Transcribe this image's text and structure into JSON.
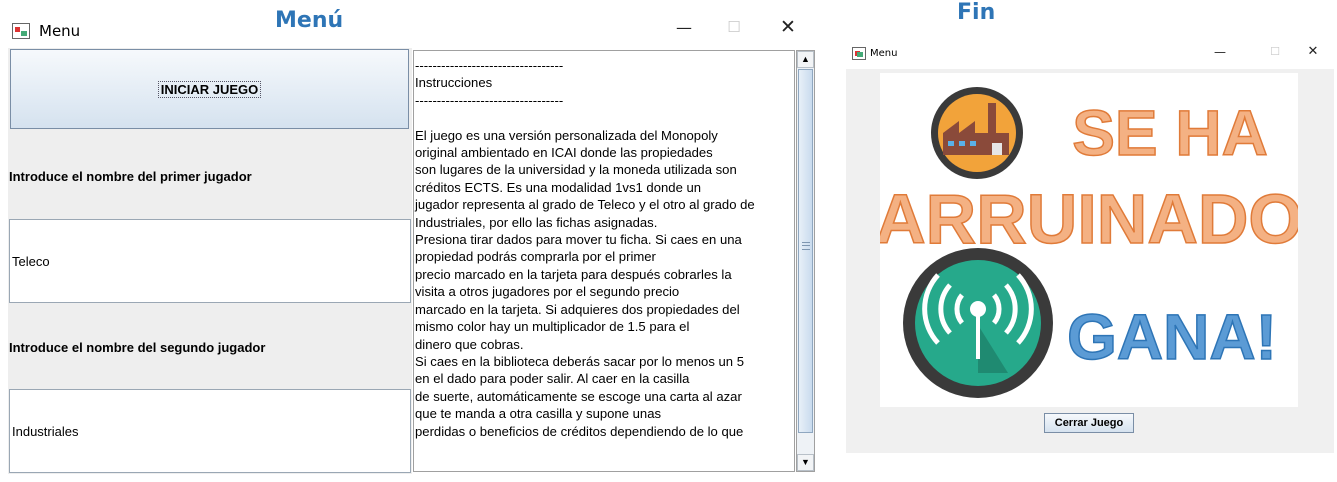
{
  "captions": {
    "menu": "Menú",
    "end": "Fin"
  },
  "menu_window": {
    "title": "Menu",
    "start_button": "INICIAR JUEGO",
    "player1_label": "Introduce el nombre del primer jugador",
    "player1_value": "Teleco",
    "player2_label": "Introduce el nombre del segundo jugador",
    "player2_value": "Industriales",
    "instructions": "----------------------------------\nInstrucciones\n----------------------------------\n\nEl juego es una versión personalizada del Monopoly\noriginal ambientado en ICAI donde las propiedades\nson lugares de la universidad y la moneda utilizada son\ncréditos ECTS. Es una modalidad 1vs1 donde un\njugador representa al grado de Teleco y el otro al grado de\nIndustriales, por ello las fichas asignadas.\nPresiona tirar dados para mover tu ficha. Si caes en una\npropiedad podrás comprarla por el primer\nprecio marcado en la tarjeta para después cobrarles la\nvisita a otros jugadores por el segundo precio\nmarcado en la tarjeta. Si adquieres dos propiedades del\nmismo color hay un multiplicador de 1.5 para el\ndinero que cobras.\nSi caes en la biblioteca deberás sacar por lo menos un 5\nen el dado para poder salir. Al caer en la casilla\nde suerte, automáticamente se escoge una carta al azar\nque te manda a otra casilla y supone unas\nperdidas o beneficios de créditos dependiendo de lo que",
    "controls": {
      "minimize": "—",
      "maximize": "☐",
      "close": "✕"
    }
  },
  "end_window": {
    "title": "Menu",
    "loser_text": "SE HA",
    "loser_text2": "ARRUINADO",
    "winner_text": "GANA!",
    "close_button": "Cerrar Juego",
    "controls": {
      "minimize": "—",
      "maximize": "☐",
      "close": "✕"
    }
  },
  "colors": {
    "caption": "#2e75b6",
    "loser_orange": "#f4b183",
    "winner_blue": "#5b9bd5"
  }
}
